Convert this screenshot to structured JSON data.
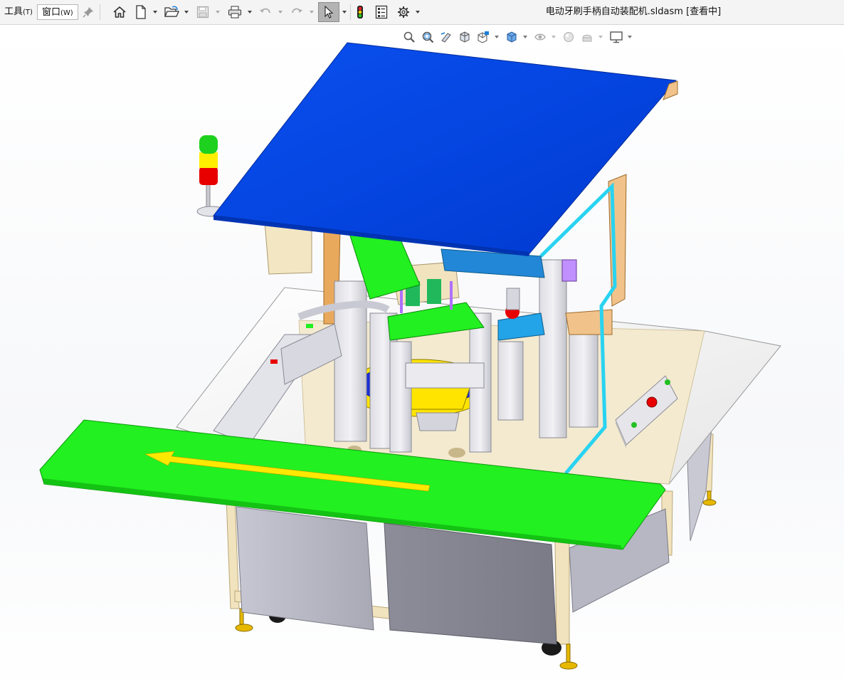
{
  "menu": {
    "tools": {
      "label": "工具",
      "accel": "(T)"
    },
    "window": {
      "label": "窗口",
      "accel": "(W)"
    }
  },
  "toolbar": {
    "icons": [
      "pin-icon",
      "home-icon",
      "new-document-icon",
      "open-icon",
      "save-icon",
      "print-icon",
      "undo-icon",
      "redo-icon",
      "select-icon",
      "rebuild-icon",
      "file-properties-icon",
      "options-icon"
    ]
  },
  "document": {
    "title": "电动牙刷手柄自动装配机.sldasm [查看中]"
  },
  "view_toolbar": {
    "icons": [
      "zoom-to-fit-icon",
      "zoom-to-area-icon",
      "previous-view-icon",
      "section-view-icon",
      "view-orientation-icon",
      "display-style-icon",
      "hide-show-items-icon",
      "edit-appearance-icon",
      "apply-scene-icon",
      "view-settings-icon"
    ]
  },
  "colors": {
    "accent_blue": "#0047e0",
    "conveyor_green": "#22f020",
    "arrow_yellow": "#ffe800",
    "frame_cream": "#f3e6c2",
    "table_white": "#f5f5f5",
    "panel_gray": "#b8b8c4",
    "cyan_frame": "#29d3f0",
    "tower_red": "#e80000",
    "tower_yellow": "#ffee00",
    "tower_green": "#1fd11f"
  }
}
